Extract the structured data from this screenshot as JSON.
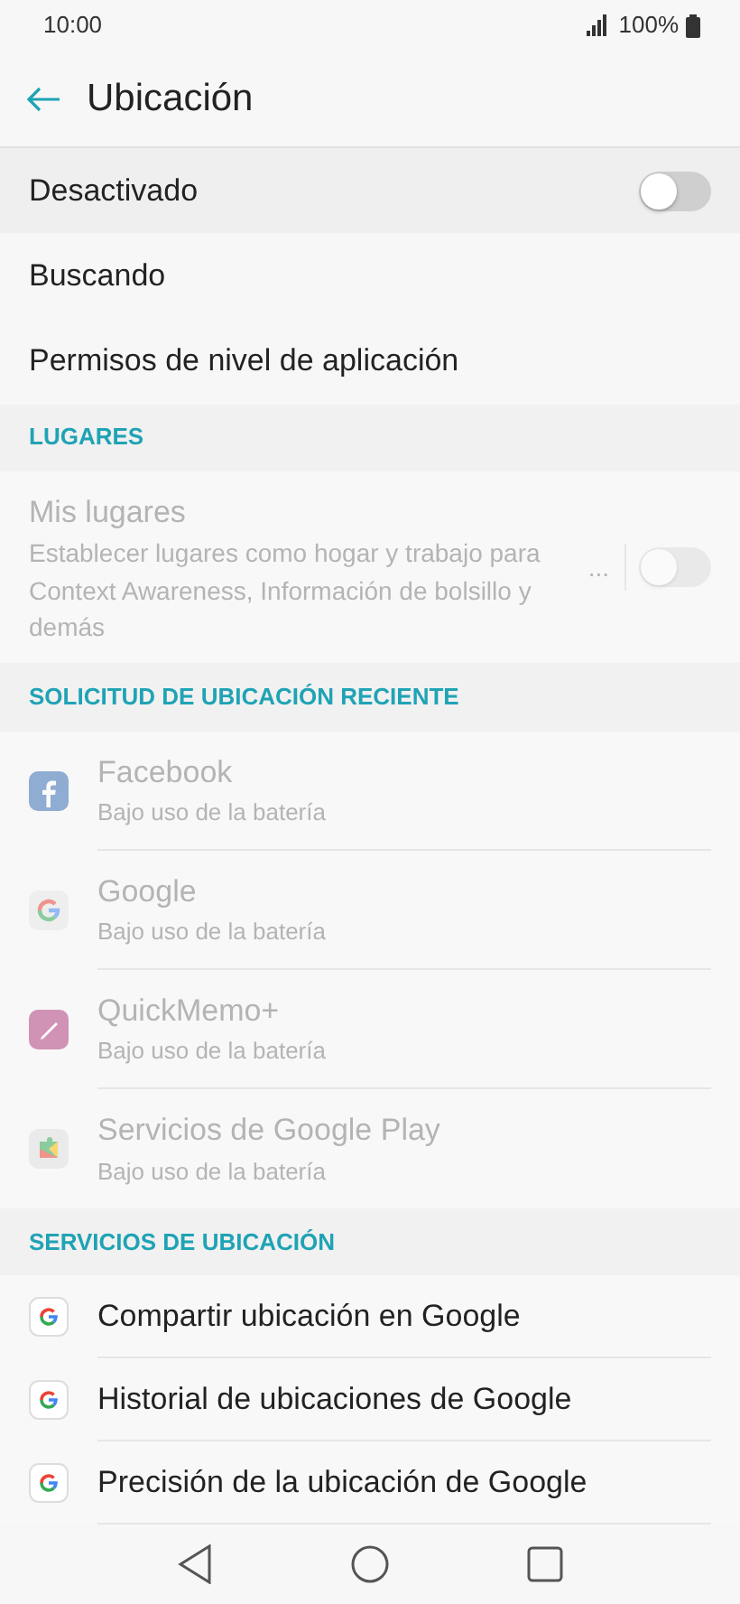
{
  "status_bar": {
    "time": "10:00",
    "battery": "100%"
  },
  "header": {
    "title": "Ubicación"
  },
  "main_settings": [
    {
      "label": "Desactivado",
      "kind": "toggle",
      "on": false
    },
    {
      "label": "Buscando",
      "kind": "plain"
    },
    {
      "label": "Permisos de nivel de aplicación",
      "kind": "plain"
    }
  ],
  "places": {
    "heading": "LUGARES",
    "item": {
      "title": "Mis lugares",
      "description": "Establecer lugares como hogar y trabajo para Context Awareness, Información de bolsillo y demás",
      "more": "...",
      "disabled": true,
      "on": false
    }
  },
  "recent": {
    "heading": "SOLICITUD DE UBICACIÓN RECIENTE",
    "disabled": true,
    "apps": [
      {
        "name": "Facebook",
        "detail": "Bajo uso de la batería"
      },
      {
        "name": "Google",
        "detail": "Bajo uso de la batería"
      },
      {
        "name": "QuickMemo+",
        "detail": "Bajo uso de la batería"
      },
      {
        "name": "Servicios de Google Play",
        "detail": "Bajo uso de la batería"
      }
    ]
  },
  "services": {
    "heading": "SERVICIOS DE UBICACIÓN",
    "items": [
      {
        "label": "Compartir ubicación en Google"
      },
      {
        "label": "Historial de ubicaciones de Google"
      },
      {
        "label": "Precisión de la ubicación de Google"
      }
    ]
  }
}
